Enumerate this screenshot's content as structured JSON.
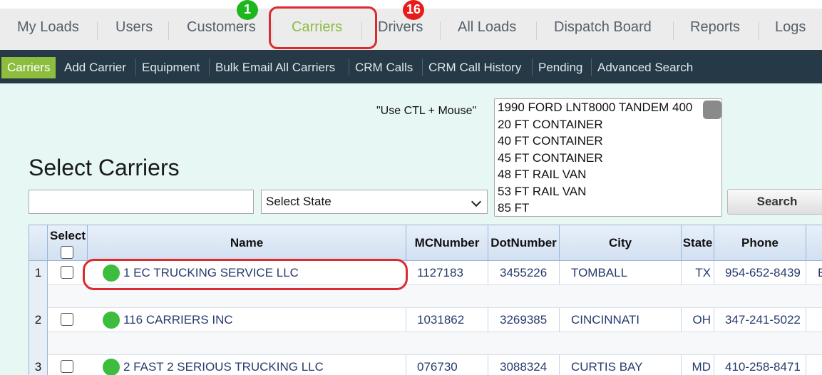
{
  "topnav": {
    "items": [
      {
        "label": "My Loads"
      },
      {
        "label": "Users"
      },
      {
        "label": "Customers",
        "badge": "1"
      },
      {
        "label": "Carriers",
        "active": true
      },
      {
        "label": "Drivers",
        "badge": "16"
      },
      {
        "label": "All Loads"
      },
      {
        "label": "Dispatch Board"
      },
      {
        "label": "Reports"
      },
      {
        "label": "Logs"
      }
    ]
  },
  "subnav": {
    "items": [
      {
        "label": "Carriers",
        "active": true
      },
      {
        "label": "Add Carrier"
      },
      {
        "label": "Equipment"
      },
      {
        "label": "Bulk Email All Carriers"
      },
      {
        "label": "CRM Calls"
      },
      {
        "label": "CRM Call History"
      },
      {
        "label": "Pending"
      },
      {
        "label": "Advanced Search"
      }
    ]
  },
  "equipment": {
    "hint": "\"Use CTL + Mouse\"",
    "options": [
      "1990 FORD LNT8000 TANDEM 400",
      "20 FT CONTAINER",
      "40 FT CONTAINER",
      "45 FT CONTAINER",
      "48 FT RAIL VAN",
      "53 FT RAIL VAN",
      "85 FT"
    ]
  },
  "page": {
    "title": "Select Carriers"
  },
  "filters": {
    "search_value": "",
    "state_selected": "Select State",
    "search_button": "Search"
  },
  "table": {
    "headers": {
      "select": "Select",
      "name": "Name",
      "mc": "MCNumber",
      "dot": "DotNumber",
      "city": "City",
      "state": "State",
      "phone": "Phone"
    },
    "rows": [
      {
        "num": "1",
        "name": "1 EC TRUCKING SERVICE LLC",
        "mc": "1127183",
        "dot": "3455226",
        "city": "TOMBALL",
        "state": "TX",
        "phone": "954-652-8439",
        "extra": "E"
      },
      {
        "num": "2",
        "name": "116 CARRIERS INC",
        "mc": "1031862",
        "dot": "3269385",
        "city": "CINCINNATI",
        "state": "OH",
        "phone": "347-241-5022",
        "extra": ""
      },
      {
        "num": "3",
        "name": "2 FAST 2 SERIOUS TRUCKING LLC",
        "mc": "076730",
        "dot": "3088324",
        "city": "CURTIS BAY",
        "state": "MD",
        "phone": "410-258-8471",
        "extra": ""
      }
    ]
  },
  "colors": {
    "accent_green": "#8dbd3f",
    "subnav_bg": "#263946",
    "page_bg": "#e6f7f4",
    "highlight_red": "#dd2a2f",
    "link_blue": "#253b6e",
    "status_green": "#3dbd3d"
  },
  "icons": {
    "status": "status-dot-green-icon",
    "dropdown": "chevron-down-icon"
  }
}
